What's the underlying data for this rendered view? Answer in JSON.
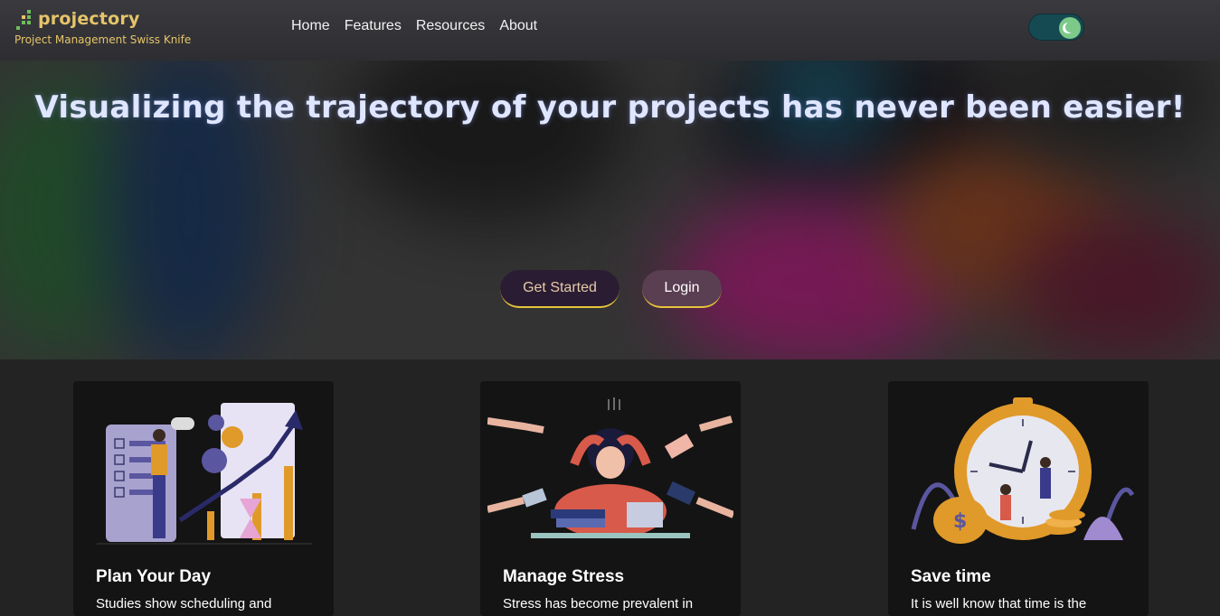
{
  "brand": {
    "name": "projectory",
    "tagline": "Project Management Swiss Knife"
  },
  "nav": [
    {
      "label": "Home"
    },
    {
      "label": "Features"
    },
    {
      "label": "Resources"
    },
    {
      "label": "About"
    }
  ],
  "theme_toggle": {
    "state": "dark",
    "icon": "moon-icon"
  },
  "hero": {
    "title": "Visualizing the trajectory of your projects has never been easier!",
    "get_started": "Get Started",
    "login": "Login"
  },
  "cards": [
    {
      "title": "Plan Your Day",
      "text": "Studies show scheduling and",
      "image": "planning-illustration"
    },
    {
      "title": "Manage Stress",
      "text": "Stress has become prevalent in",
      "image": "stress-illustration"
    },
    {
      "title": "Save time",
      "text": "It is well know that time is the",
      "image": "stopwatch-illustration"
    }
  ],
  "colors": {
    "brand": "#e6c46a",
    "accent_border": "#e6c43a",
    "toggle_track": "#164a52",
    "toggle_knob": "#7cc98a"
  }
}
